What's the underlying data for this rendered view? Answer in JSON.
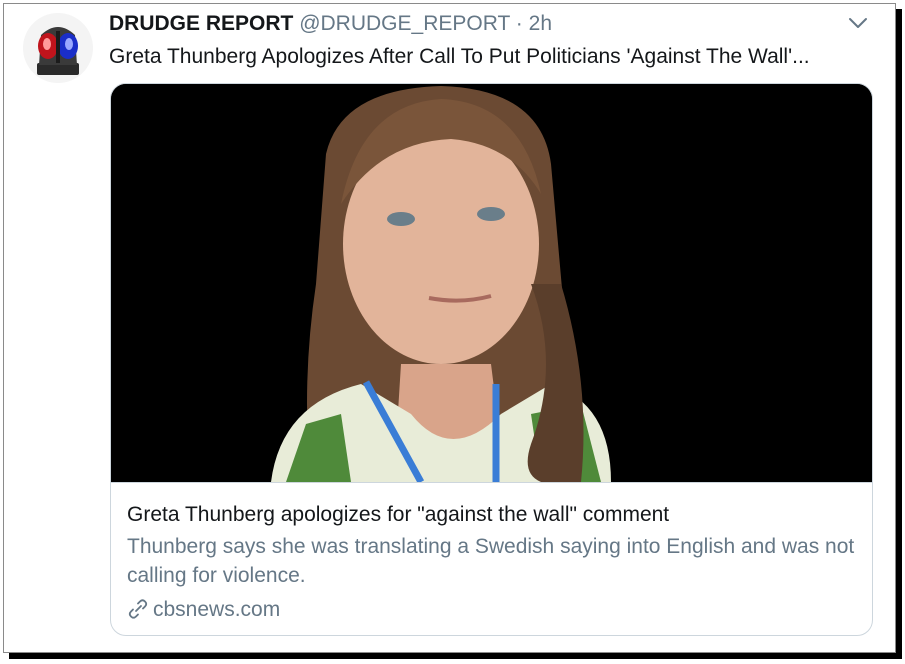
{
  "tweet": {
    "display_name": "DRUDGE REPORT",
    "handle": "@DRUDGE_REPORT",
    "separator": "·",
    "timestamp": "2h",
    "text": "Greta Thunberg Apologizes After Call To Put Politicians 'Against The Wall'...",
    "avatar_icon": "siren-icon",
    "menu_icon": "chevron-down-icon"
  },
  "card": {
    "title": "Greta Thunberg apologizes for \"against the wall\" comment",
    "description": "Thunberg says she was translating a Swedish saying into English and was not calling for violence.",
    "domain": "cbsnews.com",
    "link_icon": "link-icon"
  },
  "colors": {
    "primary_text": "#14171a",
    "secondary_text": "#657786",
    "card_border": "#cdd6dd",
    "image_background": "#000000"
  }
}
